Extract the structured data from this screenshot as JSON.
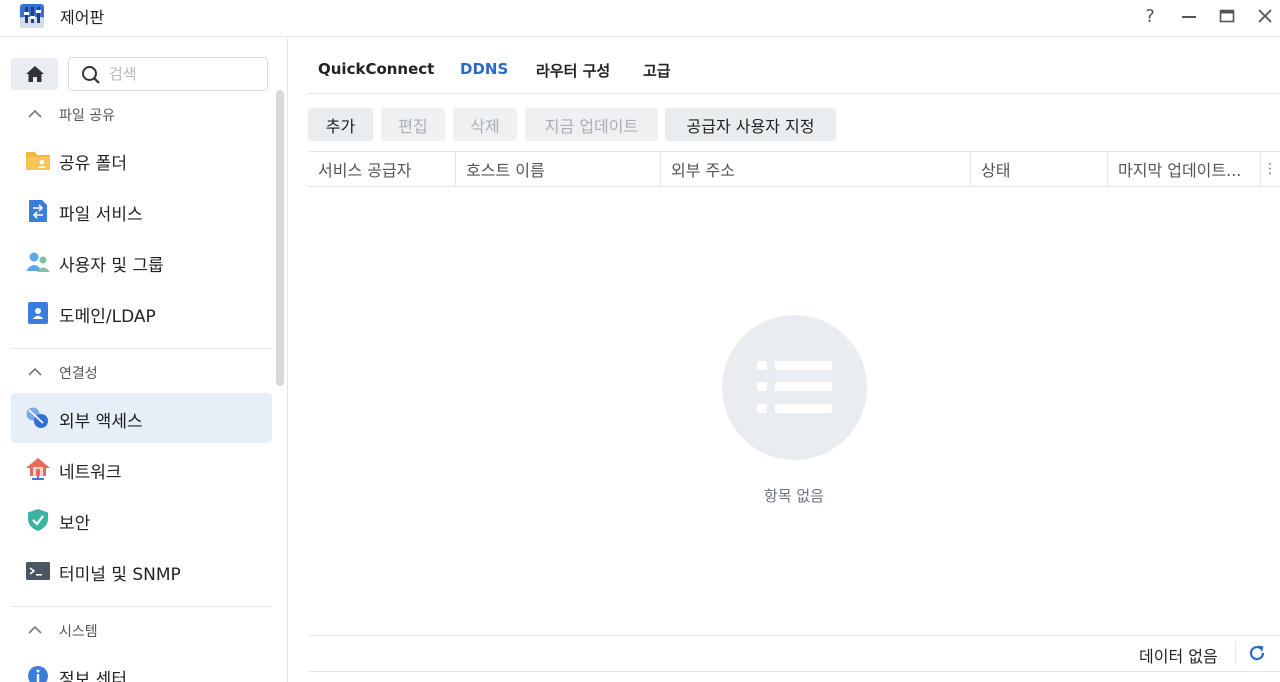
{
  "window": {
    "title": "제어판",
    "help_label": "?",
    "minimize_label": "—",
    "maximize_label": "□",
    "close_label": "✕"
  },
  "sidebar": {
    "search_placeholder": "검색",
    "sections": [
      {
        "label": "파일 공유",
        "items": [
          {
            "label": "공유 폴더",
            "icon": "folder-share-icon"
          },
          {
            "label": "파일 서비스",
            "icon": "file-services-icon"
          },
          {
            "label": "사용자 및 그룹",
            "icon": "users-icon"
          },
          {
            "label": "도메인/LDAP",
            "icon": "domain-ldap-icon"
          }
        ]
      },
      {
        "label": "연결성",
        "items": [
          {
            "label": "외부 액세스",
            "icon": "external-access-icon",
            "active": true
          },
          {
            "label": "네트워크",
            "icon": "network-icon"
          },
          {
            "label": "보안",
            "icon": "security-shield-icon"
          },
          {
            "label": "터미널 및 SNMP",
            "icon": "terminal-icon"
          }
        ]
      },
      {
        "label": "시스템",
        "items": [
          {
            "label": "정보 센터",
            "icon": "info-icon"
          }
        ]
      }
    ]
  },
  "main": {
    "tabs": [
      {
        "label": "QuickConnect"
      },
      {
        "label": "DDNS",
        "active": true
      },
      {
        "label": "라우터 구성"
      },
      {
        "label": "고급"
      }
    ],
    "toolbar": {
      "add": "추가",
      "edit": "편집",
      "delete": "삭제",
      "update_now": "지금 업데이트",
      "custom_provider": "공급자 사용자 지정"
    },
    "table": {
      "columns": [
        "서비스 공급자",
        "호스트 이름",
        "외부 주소",
        "상태",
        "마지막 업데이트..."
      ],
      "more_label": "⋮"
    },
    "empty_text": "항목 없음",
    "footer_text": "데이터 없음"
  },
  "colors": {
    "accent": "#2a6ac7",
    "active_nav_bg": "#e6eef8",
    "button_bg": "#eaedf0",
    "disabled_text": "#a9b0b7"
  }
}
